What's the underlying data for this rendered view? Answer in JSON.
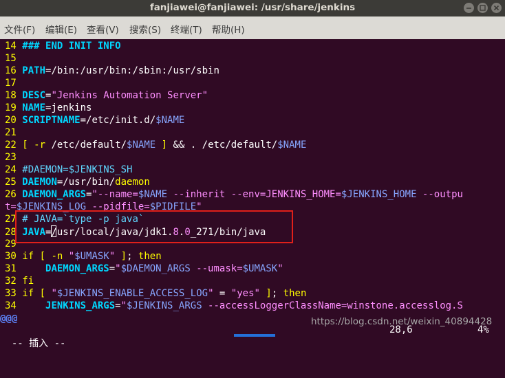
{
  "window": {
    "title": "fanjiawei@fanjiawei: /usr/share/jenkins"
  },
  "menu": [
    "文件(F)",
    "编辑(E)",
    "查看(V)",
    "搜索(S)",
    "终端(T)",
    "帮助(H)"
  ],
  "lines": [
    {
      "n": "14",
      "segs": [
        [
          "c-kw",
          "### END INIT INFO"
        ]
      ]
    },
    {
      "n": "15",
      "segs": []
    },
    {
      "n": "16",
      "segs": [
        [
          "c-kw",
          "PATH"
        ],
        [
          "c-white",
          "=/bin:/usr/bin:/sbin:/usr/sbin"
        ]
      ]
    },
    {
      "n": "17",
      "segs": []
    },
    {
      "n": "18",
      "segs": [
        [
          "c-kw",
          "DESC"
        ],
        [
          "c-white",
          "="
        ],
        [
          "c-str",
          "\"Jenkins Automation Server\""
        ]
      ]
    },
    {
      "n": "19",
      "segs": [
        [
          "c-kw",
          "NAME"
        ],
        [
          "c-white",
          "=jenkins"
        ]
      ]
    },
    {
      "n": "20",
      "segs": [
        [
          "c-kw",
          "SCRIPTNAME"
        ],
        [
          "c-white",
          "=/etc/init.d/"
        ],
        [
          "c-var",
          "$NAME"
        ]
      ]
    },
    {
      "n": "21",
      "segs": []
    },
    {
      "n": "22",
      "segs": [
        [
          "c-yel",
          "["
        ],
        [
          "c-white",
          " "
        ],
        [
          "c-yel",
          "-r"
        ],
        [
          "c-white",
          " /etc/default/"
        ],
        [
          "c-var",
          "$NAME"
        ],
        [
          "c-white",
          " "
        ],
        [
          "c-yel",
          "]"
        ],
        [
          "c-white",
          " && . /etc/default/"
        ],
        [
          "c-var",
          "$NAME"
        ]
      ]
    },
    {
      "n": "23",
      "segs": []
    },
    {
      "n": "24",
      "segs": [
        [
          "c-cmt",
          "#DAEMON=$JENKINS_SH"
        ]
      ]
    },
    {
      "n": "25",
      "segs": [
        [
          "c-kw",
          "DAEMON"
        ],
        [
          "c-white",
          "=/usr/bin/"
        ],
        [
          "c-yel",
          "daemon"
        ]
      ]
    },
    {
      "n": "26",
      "segs": [
        [
          "c-kw",
          "DAEMON_ARGS"
        ],
        [
          "c-white",
          "="
        ],
        [
          "c-str",
          "\"--name="
        ],
        [
          "c-var",
          "$NAME"
        ],
        [
          "c-str",
          " --inherit --env=JENKINS_HOME="
        ],
        [
          "c-var",
          "$JENKINS_HOME"
        ],
        [
          "c-str",
          " --outpu"
        ]
      ]
    },
    {
      "n": "",
      "segs": [
        [
          "c-str",
          "t="
        ],
        [
          "c-var",
          "$JENKINS_LOG"
        ],
        [
          "c-str",
          " --pidfile="
        ],
        [
          "c-var",
          "$PIDFILE"
        ],
        [
          "c-str",
          "\""
        ]
      ]
    },
    {
      "n": "27",
      "segs": [
        [
          "c-cmt",
          "# JAVA=`type -p java`"
        ]
      ]
    },
    {
      "n": "28",
      "segs": [
        [
          "c-kw",
          "JAVA"
        ],
        [
          "c-white",
          "="
        ],
        [
          "cursor",
          ""
        ],
        [
          "c-white",
          "/usr/local/java/jdk1."
        ],
        [
          "c-str",
          "8"
        ],
        [
          "c-white",
          "."
        ],
        [
          "c-str",
          "0"
        ],
        [
          "c-white",
          "_271/bin/java"
        ]
      ]
    },
    {
      "n": "29",
      "segs": []
    },
    {
      "n": "30",
      "segs": [
        [
          "c-yel",
          "if"
        ],
        [
          "c-white",
          " "
        ],
        [
          "c-yel",
          "["
        ],
        [
          "c-white",
          " "
        ],
        [
          "c-yel",
          "-n"
        ],
        [
          "c-white",
          " "
        ],
        [
          "c-str",
          "\""
        ],
        [
          "c-var",
          "$UMASK"
        ],
        [
          "c-str",
          "\""
        ],
        [
          "c-white",
          " "
        ],
        [
          "c-yel",
          "]"
        ],
        [
          "c-white",
          "; "
        ],
        [
          "c-yel",
          "then"
        ]
      ]
    },
    {
      "n": "31",
      "segs": [
        [
          "c-white",
          "    "
        ],
        [
          "c-kw",
          "DAEMON_ARGS"
        ],
        [
          "c-white",
          "="
        ],
        [
          "c-str",
          "\""
        ],
        [
          "c-var",
          "$DAEMON_ARGS"
        ],
        [
          "c-str",
          " --umask="
        ],
        [
          "c-var",
          "$UMASK"
        ],
        [
          "c-str",
          "\""
        ]
      ]
    },
    {
      "n": "32",
      "segs": [
        [
          "c-yel",
          "fi"
        ]
      ]
    },
    {
      "n": "33",
      "segs": [
        [
          "c-yel",
          "if"
        ],
        [
          "c-white",
          " "
        ],
        [
          "c-yel",
          "["
        ],
        [
          "c-white",
          " "
        ],
        [
          "c-str",
          "\""
        ],
        [
          "c-var",
          "$JENKINS_ENABLE_ACCESS_LOG"
        ],
        [
          "c-str",
          "\""
        ],
        [
          "c-white",
          " = "
        ],
        [
          "c-str",
          "\"yes\""
        ],
        [
          "c-white",
          " "
        ],
        [
          "c-yel",
          "]"
        ],
        [
          "c-white",
          "; "
        ],
        [
          "c-yel",
          "then"
        ]
      ]
    },
    {
      "n": "34",
      "segs": [
        [
          "c-white",
          "    "
        ],
        [
          "c-kw",
          "JENKINS_ARGS"
        ],
        [
          "c-white",
          "="
        ],
        [
          "c-str",
          "\""
        ],
        [
          "c-var",
          "$JENKINS_ARGS"
        ],
        [
          "c-str",
          " --accessLoggerClassName=winstone.accesslog.S"
        ]
      ]
    }
  ],
  "truncation_marker": "@@@",
  "status": {
    "mode": "-- 插入 --",
    "position": "28,6",
    "percent": "4%"
  },
  "watermark": "https://blog.csdn.net/weixin_40894428"
}
